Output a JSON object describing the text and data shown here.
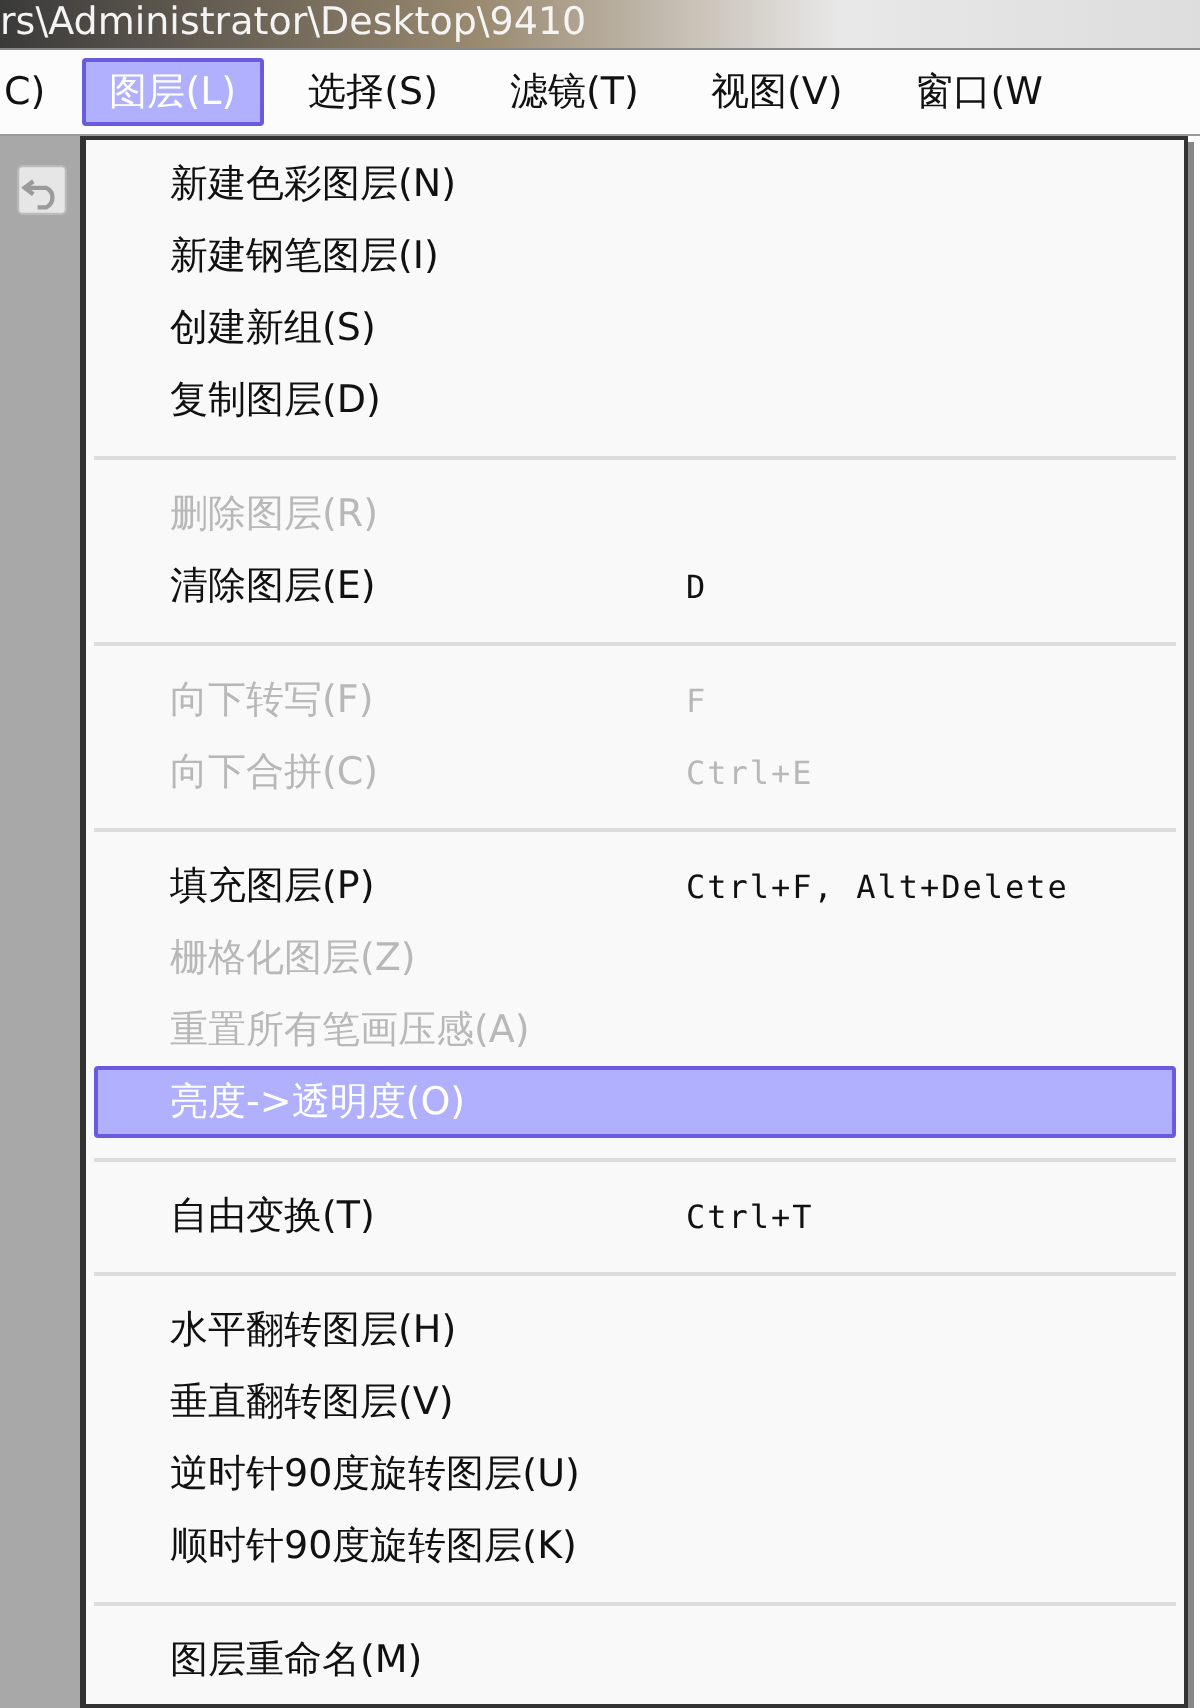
{
  "window": {
    "title": "rs\\Administrator\\Desktop\\9410"
  },
  "menubar": [
    {
      "label": "C)",
      "selected": false
    },
    {
      "label": "图层(L)",
      "selected": true
    },
    {
      "label": "选择(S)",
      "selected": false
    },
    {
      "label": "滤镜(T)",
      "selected": false
    },
    {
      "label": "视图(V)",
      "selected": false
    },
    {
      "label": "窗口(W",
      "selected": false
    }
  ],
  "menu": {
    "groups": [
      {
        "items": [
          {
            "label": "新建色彩图层(N)",
            "disabled": false,
            "selected": false
          },
          {
            "label": "新建钢笔图层(I)",
            "disabled": false,
            "selected": false
          },
          {
            "label": "创建新组(S)",
            "disabled": false,
            "selected": false
          },
          {
            "label": "复制图层(D)",
            "disabled": false,
            "selected": false
          }
        ]
      },
      {
        "items": [
          {
            "label": "删除图层(R)",
            "disabled": true,
            "selected": false
          },
          {
            "label": "清除图层(E)",
            "shortcut": "D",
            "disabled": false,
            "selected": false
          }
        ]
      },
      {
        "items": [
          {
            "label": "向下转写(F)",
            "shortcut": "F",
            "disabled": true,
            "selected": false
          },
          {
            "label": "向下合拼(C)",
            "shortcut": "Ctrl+E",
            "disabled": true,
            "selected": false
          }
        ]
      },
      {
        "items": [
          {
            "label": "填充图层(P)",
            "shortcut": "Ctrl+F, Alt+Delete",
            "disabled": false,
            "selected": false
          },
          {
            "label": "栅格化图层(Z)",
            "disabled": true,
            "selected": false
          },
          {
            "label": "重置所有笔画压感(A)",
            "disabled": true,
            "selected": false
          },
          {
            "label": "亮度->透明度(O)",
            "disabled": false,
            "selected": true
          }
        ]
      },
      {
        "items": [
          {
            "label": "自由变换(T)",
            "shortcut": "Ctrl+T",
            "disabled": false,
            "selected": false
          }
        ]
      },
      {
        "items": [
          {
            "label": "水平翻转图层(H)",
            "disabled": false,
            "selected": false
          },
          {
            "label": "垂直翻转图层(V)",
            "disabled": false,
            "selected": false
          },
          {
            "label": "逆时针90度旋转图层(U)",
            "disabled": false,
            "selected": false
          },
          {
            "label": "顺时针90度旋转图层(K)",
            "disabled": false,
            "selected": false
          }
        ]
      },
      {
        "items": [
          {
            "label": "图层重命名(M)",
            "disabled": false,
            "selected": false
          }
        ]
      }
    ]
  }
}
